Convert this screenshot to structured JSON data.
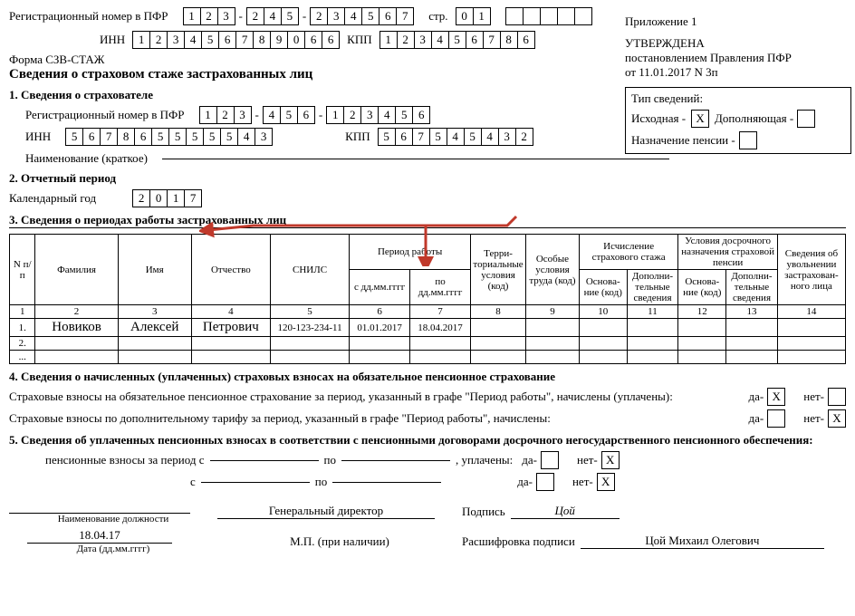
{
  "header": {
    "reg_label": "Регистрационный номер в ПФР",
    "reg_p1": [
      "1",
      "2",
      "3"
    ],
    "reg_p2": [
      "2",
      "4",
      "5"
    ],
    "reg_p3": [
      "2",
      "3",
      "4",
      "5",
      "6",
      "7"
    ],
    "page_label": "стр.",
    "page": [
      "0",
      "1"
    ],
    "extra_boxes": [
      "",
      "",
      "",
      "",
      ""
    ],
    "inn_label": "ИНН",
    "inn": [
      "1",
      "2",
      "3",
      "4",
      "5",
      "6",
      "7",
      "8",
      "9",
      "0",
      "6",
      "6"
    ],
    "kpp_label": "КПП",
    "kpp": [
      "1",
      "2",
      "3",
      "4",
      "5",
      "6",
      "7",
      "8",
      "6"
    ],
    "form_code": "Форма СЗВ-СТАЖ",
    "form_title": "Сведения о страховом стаже застрахованных лиц",
    "appendix": "Приложение 1",
    "approved": "УТВЕРЖДЕНА",
    "approved_by": "постановлением Правления ПФР",
    "approved_date": "от 11.01.2017 N 3п"
  },
  "type_panel": {
    "title": "Тип сведений:",
    "initial_label": "Исходная -",
    "initial_val": "X",
    "supplement_label": "Дополняющая -",
    "supplement_val": "",
    "pension_label": "Назначение пенсии -",
    "pension_val": ""
  },
  "sec1": {
    "title": "1. Сведения о страхователе",
    "reg_label": "Регистрационный номер в ПФР",
    "reg_p1": [
      "1",
      "2",
      "3"
    ],
    "reg_p2": [
      "4",
      "5",
      "6"
    ],
    "reg_p3": [
      "1",
      "2",
      "3",
      "4",
      "5",
      "6"
    ],
    "inn_label": "ИНН",
    "inn": [
      "5",
      "6",
      "7",
      "8",
      "6",
      "5",
      "5",
      "5",
      "5",
      "5",
      "4",
      "3"
    ],
    "kpp_label": "КПП",
    "kpp": [
      "5",
      "6",
      "7",
      "5",
      "4",
      "5",
      "4",
      "3",
      "2"
    ],
    "name_label": "Наименование (краткое)",
    "name_value": ""
  },
  "sec2": {
    "title": "2. Отчетный период",
    "year_label": "Календарный год",
    "year": [
      "2",
      "0",
      "1",
      "7"
    ]
  },
  "sec3": {
    "title": "3. Сведения о периодах работы застрахованных лиц",
    "headers": {
      "num": "N п/п",
      "surname": "Фамилия",
      "name": "Имя",
      "patronymic": "Отчество",
      "snils": "СНИЛС",
      "period": "Период работы",
      "from": "с дд.мм.гггг",
      "to": "по дд.мм.гггг",
      "terr": "Терри-\nториальные условия (код)",
      "special": "Особые условия труда (код)",
      "calc": "Исчисление страхового стажа",
      "early": "Условия досрочного назначения страховой пенсии",
      "basis": "Основа-\nние (код)",
      "addinfo": "Дополни-\nтельные сведения",
      "dismiss": "Сведения об увольнении застрахован-\nного лица"
    },
    "colnums": [
      "1",
      "2",
      "3",
      "4",
      "5",
      "6",
      "7",
      "8",
      "9",
      "10",
      "11",
      "12",
      "13",
      "14"
    ],
    "rows": [
      {
        "n": "1.",
        "surname": "Новиков",
        "name": "Алексей",
        "patronymic": "Петрович",
        "snils": "120-123-234-11",
        "from": "01.01.2017",
        "to": "18.04.2017"
      },
      {
        "n": "2.",
        "surname": "",
        "name": "",
        "patronymic": "",
        "snils": "",
        "from": "",
        "to": ""
      },
      {
        "n": "...",
        "surname": "",
        "name": "",
        "patronymic": "",
        "snils": "",
        "from": "",
        "to": ""
      }
    ]
  },
  "sec4": {
    "title": "4. Сведения о начисленных (уплаченных) страховых взносах на обязательное пенсионное страхование",
    "line1": "Страховые взносы на обязательное пенсионное страхование за период, указанный в графе \"Период работы\", начислены (уплачены):",
    "line2": "Страховые взносы по дополнительному тарифу за период, указанный в графе \"Период работы\", начислены:",
    "da": "да-",
    "net": "нет-",
    "r1_da": "X",
    "r1_net": "",
    "r2_da": "",
    "r2_net": "X"
  },
  "sec5": {
    "title": "5. Сведения об уплаченных пенсионных взносах в соответствии с пенсионными договорами досрочного негосударственного пенсионного обеспечения:",
    "contrib_label": "пенсионные взносы за период с",
    "s_label": "с",
    "po_label": "по",
    "paid_label": ", уплачены:",
    "da": "да-",
    "net": "нет-",
    "r1_da": "",
    "r1_net": "X",
    "r2_da": "",
    "r2_net": "X"
  },
  "signature": {
    "position_label": "Наименование должности",
    "position_value": "Генеральный директор",
    "sign_label": "Подпись",
    "sign_value": "Цой",
    "decode_label": "Расшифровка подписи",
    "decode_value": "Цой Михаил Олегович",
    "date_value": "18.04.17",
    "date_label": "Дата (дд.мм.гггг)",
    "stamp": "М.П. (при наличии)"
  }
}
